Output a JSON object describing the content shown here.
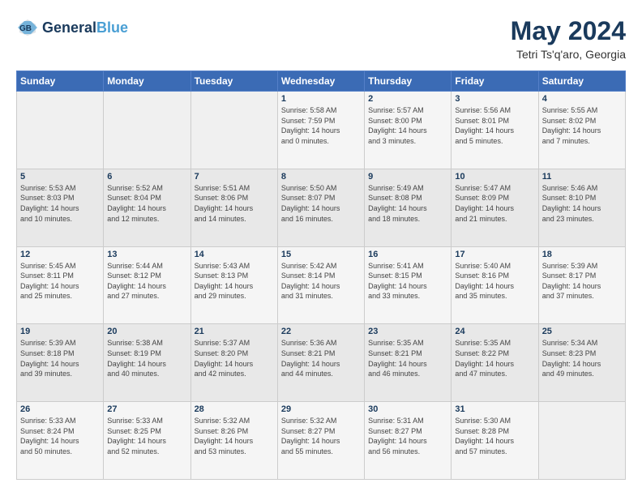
{
  "brand": {
    "name_part1": "General",
    "name_part2": "Blue"
  },
  "header": {
    "title": "May 2024",
    "subtitle": "Tetri Ts'q'aro, Georgia"
  },
  "weekdays": [
    "Sunday",
    "Monday",
    "Tuesday",
    "Wednesday",
    "Thursday",
    "Friday",
    "Saturday"
  ],
  "weeks": [
    [
      {
        "day": "",
        "info": ""
      },
      {
        "day": "",
        "info": ""
      },
      {
        "day": "",
        "info": ""
      },
      {
        "day": "1",
        "info": "Sunrise: 5:58 AM\nSunset: 7:59 PM\nDaylight: 14 hours\nand 0 minutes."
      },
      {
        "day": "2",
        "info": "Sunrise: 5:57 AM\nSunset: 8:00 PM\nDaylight: 14 hours\nand 3 minutes."
      },
      {
        "day": "3",
        "info": "Sunrise: 5:56 AM\nSunset: 8:01 PM\nDaylight: 14 hours\nand 5 minutes."
      },
      {
        "day": "4",
        "info": "Sunrise: 5:55 AM\nSunset: 8:02 PM\nDaylight: 14 hours\nand 7 minutes."
      }
    ],
    [
      {
        "day": "5",
        "info": "Sunrise: 5:53 AM\nSunset: 8:03 PM\nDaylight: 14 hours\nand 10 minutes."
      },
      {
        "day": "6",
        "info": "Sunrise: 5:52 AM\nSunset: 8:04 PM\nDaylight: 14 hours\nand 12 minutes."
      },
      {
        "day": "7",
        "info": "Sunrise: 5:51 AM\nSunset: 8:06 PM\nDaylight: 14 hours\nand 14 minutes."
      },
      {
        "day": "8",
        "info": "Sunrise: 5:50 AM\nSunset: 8:07 PM\nDaylight: 14 hours\nand 16 minutes."
      },
      {
        "day": "9",
        "info": "Sunrise: 5:49 AM\nSunset: 8:08 PM\nDaylight: 14 hours\nand 18 minutes."
      },
      {
        "day": "10",
        "info": "Sunrise: 5:47 AM\nSunset: 8:09 PM\nDaylight: 14 hours\nand 21 minutes."
      },
      {
        "day": "11",
        "info": "Sunrise: 5:46 AM\nSunset: 8:10 PM\nDaylight: 14 hours\nand 23 minutes."
      }
    ],
    [
      {
        "day": "12",
        "info": "Sunrise: 5:45 AM\nSunset: 8:11 PM\nDaylight: 14 hours\nand 25 minutes."
      },
      {
        "day": "13",
        "info": "Sunrise: 5:44 AM\nSunset: 8:12 PM\nDaylight: 14 hours\nand 27 minutes."
      },
      {
        "day": "14",
        "info": "Sunrise: 5:43 AM\nSunset: 8:13 PM\nDaylight: 14 hours\nand 29 minutes."
      },
      {
        "day": "15",
        "info": "Sunrise: 5:42 AM\nSunset: 8:14 PM\nDaylight: 14 hours\nand 31 minutes."
      },
      {
        "day": "16",
        "info": "Sunrise: 5:41 AM\nSunset: 8:15 PM\nDaylight: 14 hours\nand 33 minutes."
      },
      {
        "day": "17",
        "info": "Sunrise: 5:40 AM\nSunset: 8:16 PM\nDaylight: 14 hours\nand 35 minutes."
      },
      {
        "day": "18",
        "info": "Sunrise: 5:39 AM\nSunset: 8:17 PM\nDaylight: 14 hours\nand 37 minutes."
      }
    ],
    [
      {
        "day": "19",
        "info": "Sunrise: 5:39 AM\nSunset: 8:18 PM\nDaylight: 14 hours\nand 39 minutes."
      },
      {
        "day": "20",
        "info": "Sunrise: 5:38 AM\nSunset: 8:19 PM\nDaylight: 14 hours\nand 40 minutes."
      },
      {
        "day": "21",
        "info": "Sunrise: 5:37 AM\nSunset: 8:20 PM\nDaylight: 14 hours\nand 42 minutes."
      },
      {
        "day": "22",
        "info": "Sunrise: 5:36 AM\nSunset: 8:21 PM\nDaylight: 14 hours\nand 44 minutes."
      },
      {
        "day": "23",
        "info": "Sunrise: 5:35 AM\nSunset: 8:21 PM\nDaylight: 14 hours\nand 46 minutes."
      },
      {
        "day": "24",
        "info": "Sunrise: 5:35 AM\nSunset: 8:22 PM\nDaylight: 14 hours\nand 47 minutes."
      },
      {
        "day": "25",
        "info": "Sunrise: 5:34 AM\nSunset: 8:23 PM\nDaylight: 14 hours\nand 49 minutes."
      }
    ],
    [
      {
        "day": "26",
        "info": "Sunrise: 5:33 AM\nSunset: 8:24 PM\nDaylight: 14 hours\nand 50 minutes."
      },
      {
        "day": "27",
        "info": "Sunrise: 5:33 AM\nSunset: 8:25 PM\nDaylight: 14 hours\nand 52 minutes."
      },
      {
        "day": "28",
        "info": "Sunrise: 5:32 AM\nSunset: 8:26 PM\nDaylight: 14 hours\nand 53 minutes."
      },
      {
        "day": "29",
        "info": "Sunrise: 5:32 AM\nSunset: 8:27 PM\nDaylight: 14 hours\nand 55 minutes."
      },
      {
        "day": "30",
        "info": "Sunrise: 5:31 AM\nSunset: 8:27 PM\nDaylight: 14 hours\nand 56 minutes."
      },
      {
        "day": "31",
        "info": "Sunrise: 5:30 AM\nSunset: 8:28 PM\nDaylight: 14 hours\nand 57 minutes."
      },
      {
        "day": "",
        "info": ""
      }
    ]
  ]
}
